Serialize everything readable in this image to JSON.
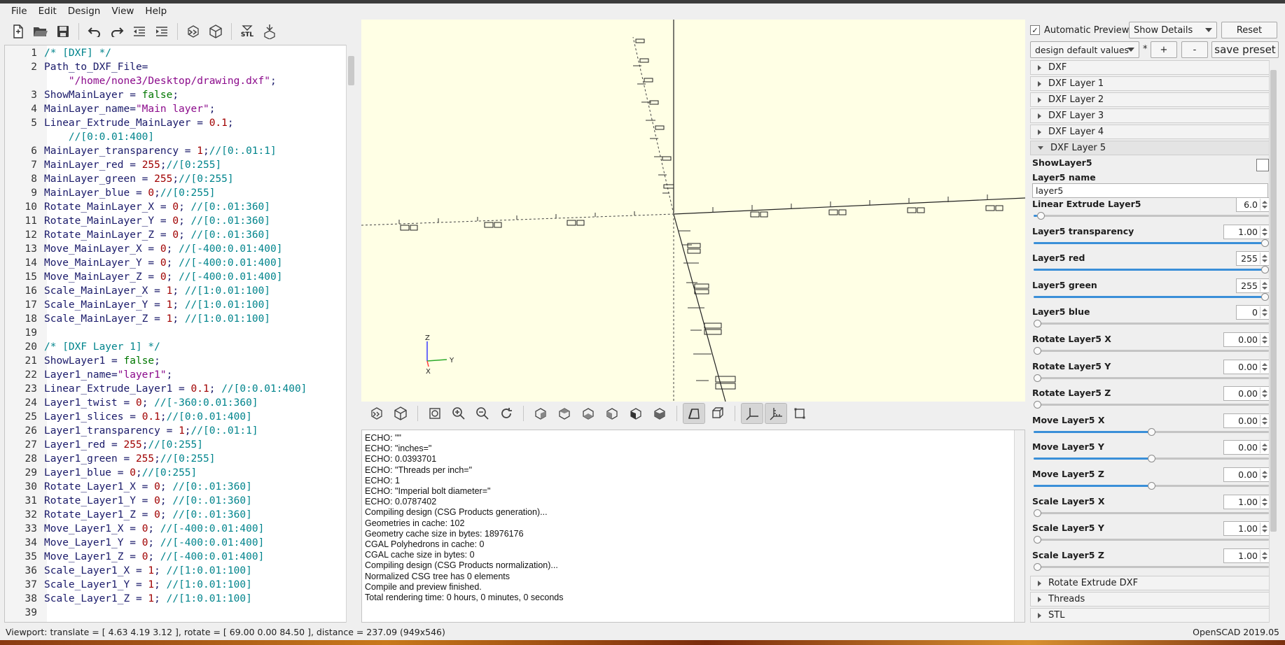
{
  "menu": [
    "File",
    "Edit",
    "Design",
    "View",
    "Help"
  ],
  "toolbar": {
    "icons": [
      "new-file-icon",
      "open-file-icon",
      "save-icon",
      "undo-icon",
      "redo-icon",
      "unindent-icon",
      "indent-icon",
      "preview-icon",
      "render-icon",
      "export-stl-icon",
      "send-to-print-icon"
    ],
    "stl_label": "STL"
  },
  "editor": {
    "lines": [
      {
        "n": "1",
        "parts": [
          [
            "c-cm",
            "/* [DXF] */"
          ]
        ]
      },
      {
        "n": "2",
        "parts": [
          [
            "c-id",
            "Path_to_DXF_File="
          ]
        ]
      },
      {
        "n": "",
        "parts": [
          [
            "c-str",
            "    \"/home/none3/Desktop/drawing.dxf\""
          ],
          [
            "c-id",
            ";"
          ]
        ]
      },
      {
        "n": "3",
        "parts": [
          [
            "c-id",
            "ShowMainLayer = "
          ],
          [
            "c-kw",
            "false"
          ],
          [
            "c-id",
            ";"
          ]
        ]
      },
      {
        "n": "4",
        "parts": [
          [
            "c-id",
            "MainLayer_name="
          ],
          [
            "c-str",
            "\"Main layer\""
          ],
          [
            "c-id",
            ";"
          ]
        ]
      },
      {
        "n": "5",
        "parts": [
          [
            "c-id",
            "Linear_Extrude_MainLayer = "
          ],
          [
            "c-num",
            "0.1"
          ],
          [
            "c-id",
            ";"
          ]
        ]
      },
      {
        "n": "",
        "parts": [
          [
            "c-cm",
            "    //[0:0.01:400]"
          ]
        ]
      },
      {
        "n": "6",
        "parts": [
          [
            "c-id",
            "MainLayer_transparency = "
          ],
          [
            "c-num",
            "1"
          ],
          [
            "c-id",
            ";"
          ],
          [
            "c-cm",
            "//[0:.01:1]"
          ]
        ]
      },
      {
        "n": "7",
        "parts": [
          [
            "c-id",
            "MainLayer_red = "
          ],
          [
            "c-num",
            "255"
          ],
          [
            "c-id",
            ";"
          ],
          [
            "c-cm",
            "//[0:255]"
          ]
        ]
      },
      {
        "n": "8",
        "parts": [
          [
            "c-id",
            "MainLayer_green = "
          ],
          [
            "c-num",
            "255"
          ],
          [
            "c-id",
            ";"
          ],
          [
            "c-cm",
            "//[0:255]"
          ]
        ]
      },
      {
        "n": "9",
        "parts": [
          [
            "c-id",
            "MainLayer_blue = "
          ],
          [
            "c-num",
            "0"
          ],
          [
            "c-id",
            ";"
          ],
          [
            "c-cm",
            "//[0:255]"
          ]
        ]
      },
      {
        "n": "10",
        "parts": [
          [
            "c-id",
            "Rotate_MainLayer_X = "
          ],
          [
            "c-num",
            "0"
          ],
          [
            "c-id",
            "; "
          ],
          [
            "c-cm",
            "//[0:.01:360]"
          ]
        ]
      },
      {
        "n": "11",
        "parts": [
          [
            "c-id",
            "Rotate_MainLayer_Y = "
          ],
          [
            "c-num",
            "0"
          ],
          [
            "c-id",
            "; "
          ],
          [
            "c-cm",
            "//[0:.01:360]"
          ]
        ]
      },
      {
        "n": "12",
        "parts": [
          [
            "c-id",
            "Rotate_MainLayer_Z = "
          ],
          [
            "c-num",
            "0"
          ],
          [
            "c-id",
            "; "
          ],
          [
            "c-cm",
            "//[0:.01:360]"
          ]
        ]
      },
      {
        "n": "13",
        "parts": [
          [
            "c-id",
            "Move_MainLayer_X = "
          ],
          [
            "c-num",
            "0"
          ],
          [
            "c-id",
            "; "
          ],
          [
            "c-cm",
            "//[-400:0.01:400]"
          ]
        ]
      },
      {
        "n": "14",
        "parts": [
          [
            "c-id",
            "Move_MainLayer_Y = "
          ],
          [
            "c-num",
            "0"
          ],
          [
            "c-id",
            "; "
          ],
          [
            "c-cm",
            "//[-400:0.01:400]"
          ]
        ]
      },
      {
        "n": "15",
        "parts": [
          [
            "c-id",
            "Move_MainLayer_Z = "
          ],
          [
            "c-num",
            "0"
          ],
          [
            "c-id",
            "; "
          ],
          [
            "c-cm",
            "//[-400:0.01:400]"
          ]
        ]
      },
      {
        "n": "16",
        "parts": [
          [
            "c-id",
            "Scale_MainLayer_X = "
          ],
          [
            "c-num",
            "1"
          ],
          [
            "c-id",
            "; "
          ],
          [
            "c-cm",
            "//[1:0.01:100]"
          ]
        ]
      },
      {
        "n": "17",
        "parts": [
          [
            "c-id",
            "Scale_MainLayer_Y = "
          ],
          [
            "c-num",
            "1"
          ],
          [
            "c-id",
            "; "
          ],
          [
            "c-cm",
            "//[1:0.01:100]"
          ]
        ]
      },
      {
        "n": "18",
        "parts": [
          [
            "c-id",
            "Scale_MainLayer_Z = "
          ],
          [
            "c-num",
            "1"
          ],
          [
            "c-id",
            "; "
          ],
          [
            "c-cm",
            "//[1:0.01:100]"
          ]
        ]
      },
      {
        "n": "19",
        "parts": []
      },
      {
        "n": "20",
        "parts": [
          [
            "c-cm",
            "/* [DXF Layer 1] */"
          ]
        ]
      },
      {
        "n": "21",
        "parts": [
          [
            "c-id",
            "ShowLayer1 = "
          ],
          [
            "c-kw",
            "false"
          ],
          [
            "c-id",
            ";"
          ]
        ]
      },
      {
        "n": "22",
        "parts": [
          [
            "c-id",
            "Layer1_name="
          ],
          [
            "c-str",
            "\"layer1\""
          ],
          [
            "c-id",
            ";"
          ]
        ]
      },
      {
        "n": "23",
        "parts": [
          [
            "c-id",
            "Linear_Extrude_Layer1 = "
          ],
          [
            "c-num",
            "0.1"
          ],
          [
            "c-id",
            "; "
          ],
          [
            "c-cm",
            "//[0:0.01:400]"
          ]
        ]
      },
      {
        "n": "24",
        "parts": [
          [
            "c-id",
            "Layer1_twist = "
          ],
          [
            "c-num",
            "0"
          ],
          [
            "c-id",
            "; "
          ],
          [
            "c-cm",
            "//[-360:0.01:360]"
          ]
        ]
      },
      {
        "n": "25",
        "parts": [
          [
            "c-id",
            "Layer1_slices = "
          ],
          [
            "c-num",
            "0.1"
          ],
          [
            "c-id",
            ";"
          ],
          [
            "c-cm",
            "//[0:0.01:400]"
          ]
        ]
      },
      {
        "n": "26",
        "parts": [
          [
            "c-id",
            "Layer1_transparency = "
          ],
          [
            "c-num",
            "1"
          ],
          [
            "c-id",
            ";"
          ],
          [
            "c-cm",
            "//[0:.01:1]"
          ]
        ]
      },
      {
        "n": "27",
        "parts": [
          [
            "c-id",
            "Layer1_red = "
          ],
          [
            "c-num",
            "255"
          ],
          [
            "c-id",
            ";"
          ],
          [
            "c-cm",
            "//[0:255]"
          ]
        ]
      },
      {
        "n": "28",
        "parts": [
          [
            "c-id",
            "Layer1_green = "
          ],
          [
            "c-num",
            "255"
          ],
          [
            "c-id",
            ";"
          ],
          [
            "c-cm",
            "//[0:255]"
          ]
        ]
      },
      {
        "n": "29",
        "parts": [
          [
            "c-id",
            "Layer1_blue = "
          ],
          [
            "c-num",
            "0"
          ],
          [
            "c-id",
            ";"
          ],
          [
            "c-cm",
            "//[0:255]"
          ]
        ]
      },
      {
        "n": "30",
        "parts": [
          [
            "c-id",
            "Rotate_Layer1_X = "
          ],
          [
            "c-num",
            "0"
          ],
          [
            "c-id",
            "; "
          ],
          [
            "c-cm",
            "//[0:.01:360]"
          ]
        ]
      },
      {
        "n": "31",
        "parts": [
          [
            "c-id",
            "Rotate_Layer1_Y = "
          ],
          [
            "c-num",
            "0"
          ],
          [
            "c-id",
            "; "
          ],
          [
            "c-cm",
            "//[0:.01:360]"
          ]
        ]
      },
      {
        "n": "32",
        "parts": [
          [
            "c-id",
            "Rotate_Layer1_Z = "
          ],
          [
            "c-num",
            "0"
          ],
          [
            "c-id",
            "; "
          ],
          [
            "c-cm",
            "//[0:.01:360]"
          ]
        ]
      },
      {
        "n": "33",
        "parts": [
          [
            "c-id",
            "Move_Layer1_X = "
          ],
          [
            "c-num",
            "0"
          ],
          [
            "c-id",
            "; "
          ],
          [
            "c-cm",
            "//[-400:0.01:400]"
          ]
        ]
      },
      {
        "n": "34",
        "parts": [
          [
            "c-id",
            "Move_Layer1_Y = "
          ],
          [
            "c-num",
            "0"
          ],
          [
            "c-id",
            "; "
          ],
          [
            "c-cm",
            "//[-400:0.01:400]"
          ]
        ]
      },
      {
        "n": "35",
        "parts": [
          [
            "c-id",
            "Move_Layer1_Z = "
          ],
          [
            "c-num",
            "0"
          ],
          [
            "c-id",
            "; "
          ],
          [
            "c-cm",
            "//[-400:0.01:400]"
          ]
        ]
      },
      {
        "n": "36",
        "parts": [
          [
            "c-id",
            "Scale_Layer1_X = "
          ],
          [
            "c-num",
            "1"
          ],
          [
            "c-id",
            "; "
          ],
          [
            "c-cm",
            "//[1:0.01:100]"
          ]
        ]
      },
      {
        "n": "37",
        "parts": [
          [
            "c-id",
            "Scale_Layer1_Y = "
          ],
          [
            "c-num",
            "1"
          ],
          [
            "c-id",
            "; "
          ],
          [
            "c-cm",
            "//[1:0.01:100]"
          ]
        ]
      },
      {
        "n": "38",
        "parts": [
          [
            "c-id",
            "Scale_Layer1_Z = "
          ],
          [
            "c-num",
            "1"
          ],
          [
            "c-id",
            "; "
          ],
          [
            "c-cm",
            "//[1:0.01:100]"
          ]
        ]
      },
      {
        "n": "39",
        "parts": []
      }
    ]
  },
  "viewport": {
    "axis_labels": {
      "z": "Z",
      "y": "Y",
      "x": "X"
    },
    "background": "#ffffe5"
  },
  "view_toolbar": {
    "icons": [
      "preview-icon",
      "render-icon",
      "view-all-icon",
      "zoom-in-icon",
      "zoom-out-icon",
      "reset-view-icon",
      "view-right-icon",
      "view-top-icon",
      "view-bottom-icon",
      "view-left-icon",
      "view-front-icon",
      "view-back-icon",
      "perspective-icon",
      "orthogonal-icon",
      "show-axes-icon",
      "show-scale-markers-icon",
      "show-edges-icon"
    ],
    "active": [
      "perspective-icon",
      "show-axes-icon",
      "show-scale-markers-icon"
    ]
  },
  "console": [
    "ECHO: \"\"",
    "ECHO: \"inches=\"",
    "ECHO: 0.0393701",
    "ECHO: \"Threads per inch=\"",
    "ECHO: 1",
    "ECHO: \"Imperial bolt diameter=\"",
    "ECHO: 0.0787402",
    "Compiling design (CSG Products generation)...",
    "Geometries in cache: 102",
    "Geometry cache size in bytes: 18976176",
    "CGAL Polyhedrons in cache: 0",
    "CGAL cache size in bytes: 0",
    "Compiling design (CSG Products normalization)...",
    "Normalized CSG tree has 0 elements",
    "Compile and preview finished.",
    "Total rendering time: 0 hours, 0 minutes, 0 seconds"
  ],
  "customizer": {
    "auto_preview_label": "Automatic Preview",
    "auto_preview_checked": true,
    "details_combo": "Show Details",
    "reset_label": "Reset",
    "preset_combo": "design default values",
    "preset_star": "*",
    "add_label": "+",
    "remove_label": "-",
    "save_preset_label": "save preset",
    "groups_top": [
      "DXF",
      "DXF Layer 1",
      "DXF Layer 2",
      "DXF Layer 3",
      "DXF Layer 4"
    ],
    "open_group": "DXF Layer 5",
    "show_layer_label": "ShowLayer5",
    "show_layer_checked": false,
    "name_label": "Layer5 name",
    "name_value": "layer5",
    "params": [
      {
        "label": "Linear Extrude Layer5",
        "value": "6.0",
        "fraction": 0.015
      },
      {
        "label": "Layer5 transparency",
        "value": "1.00",
        "fraction": 1.0
      },
      {
        "label": "Layer5 red",
        "value": "255",
        "fraction": 1.0
      },
      {
        "label": "Layer5 green",
        "value": "255",
        "fraction": 1.0
      },
      {
        "label": "Layer5 blue",
        "value": "0",
        "fraction": 0.0
      },
      {
        "label": "Rotate Layer5 X",
        "value": "0.00",
        "fraction": 0.0
      },
      {
        "label": "Rotate Layer5 Y",
        "value": "0.00",
        "fraction": 0.0
      },
      {
        "label": "Rotate Layer5 Z",
        "value": "0.00",
        "fraction": 0.0
      },
      {
        "label": "Move Layer5 X",
        "value": "0.00",
        "fraction": 0.5
      },
      {
        "label": "Move Layer5 Y",
        "value": "0.00",
        "fraction": 0.5
      },
      {
        "label": "Move Layer5 Z",
        "value": "0.00",
        "fraction": 0.5
      },
      {
        "label": "Scale Layer5 X",
        "value": "1.00",
        "fraction": 0.0
      },
      {
        "label": "Scale Layer5 Y",
        "value": "1.00",
        "fraction": 0.0
      },
      {
        "label": "Scale Layer5 Z",
        "value": "1.00",
        "fraction": 0.0
      }
    ],
    "groups_bottom": [
      "Rotate Extrude DXF",
      "Threads",
      "STL"
    ],
    "accent": "#3a8fd8"
  },
  "status": {
    "viewport": "Viewport: translate = [ 4.63 4.19 3.12 ], rotate = [ 69.00 0.00 84.50 ], distance = 237.09 (949x546)",
    "version": "OpenSCAD 2019.05"
  }
}
